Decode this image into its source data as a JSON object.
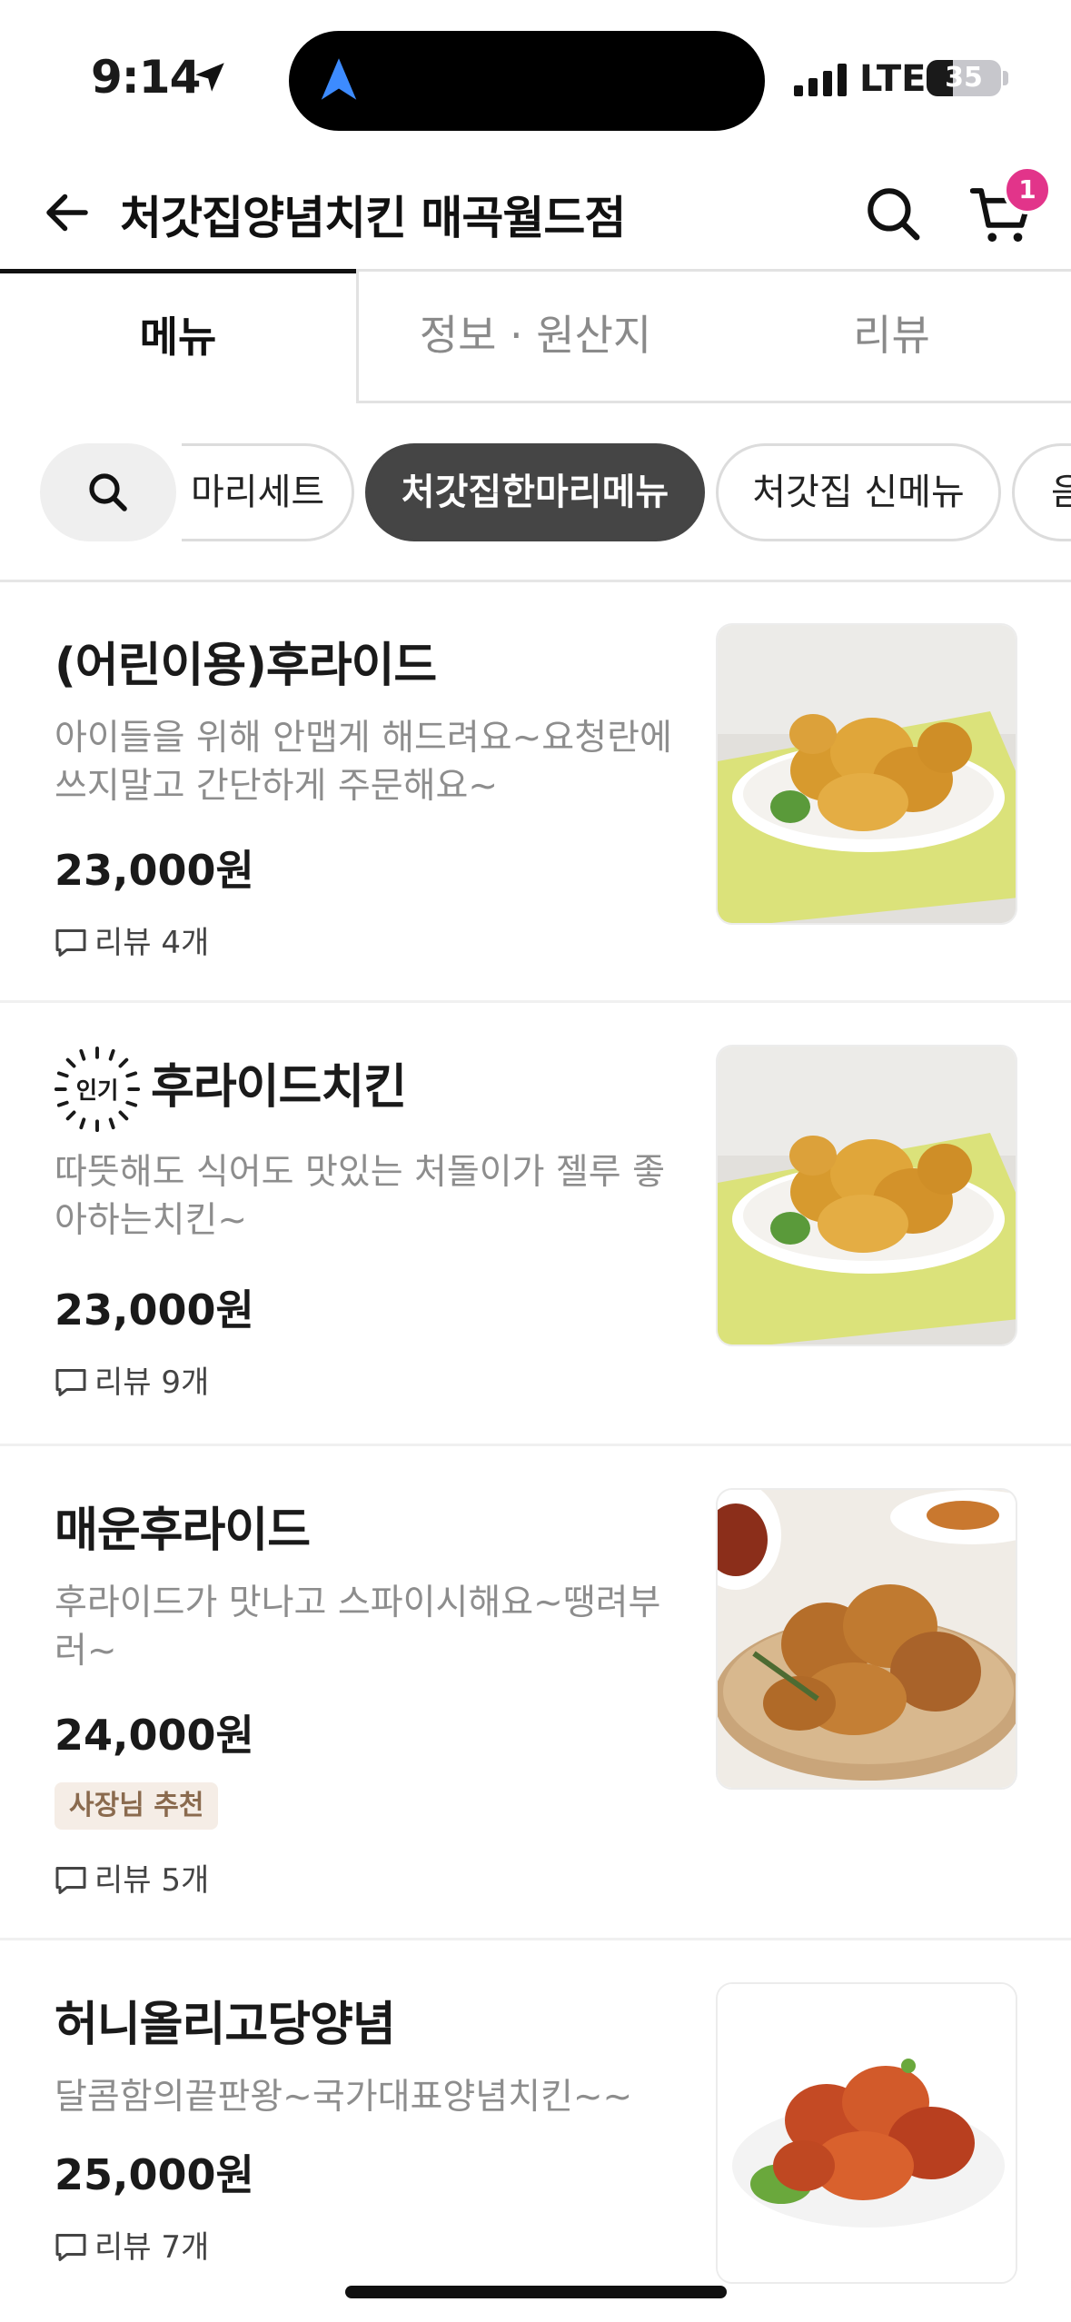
{
  "status_bar": {
    "time": "9:14",
    "network": "LTE",
    "battery": "35",
    "battery_level": 0.35
  },
  "header": {
    "title": "처갓집양념치킨 매곡월드점",
    "cart_count": "1"
  },
  "tabs": [
    {
      "label": "메뉴",
      "active": true
    },
    {
      "label": "정보 · 원산지",
      "active": false
    },
    {
      "label": "리뷰",
      "active": false
    }
  ],
  "categories": [
    {
      "label": "마리세트",
      "active": false
    },
    {
      "label": "처갓집한마리메뉴",
      "active": true
    },
    {
      "label": "처갓집 신메뉴",
      "active": false
    },
    {
      "label": "음",
      "active": false
    }
  ],
  "menu_items": [
    {
      "name": "(어린이용)후라이드",
      "desc": "아이들을 위해 안맵게 해드려요~요청란에 쓰지말고 간단하게 주문해요~",
      "price": "23,000원",
      "reviews": "리뷰 4개",
      "image": "fried-chicken-plate"
    },
    {
      "name": "후라이드치킨",
      "badge": "인기",
      "desc": "따뜻해도 식어도 맛있는 처돌이가 젤루 좋아하는치킨~",
      "price": "23,000원",
      "reviews": "리뷰 9개",
      "image": "fried-chicken-plate"
    },
    {
      "name": "매운후라이드",
      "desc": "후라이드가 맛나고 스파이시해요~땡려부러~",
      "price": "24,000원",
      "tag": "사장님 추천",
      "reviews": "리뷰 5개",
      "image": "spicy-fried-chicken-board"
    },
    {
      "name": "허니올리고당양념",
      "desc": "달콤함의끝판왕~국가대표양념치킨~~",
      "price": "25,000원",
      "reviews": "리뷰 7개",
      "image": "glazed-chicken-plate"
    }
  ],
  "colors": {
    "badge_pink": "#e2348a",
    "chip_active": "#454545",
    "owner_badge_bg": "#f5ede6",
    "owner_badge_text": "#8a6a4e"
  }
}
